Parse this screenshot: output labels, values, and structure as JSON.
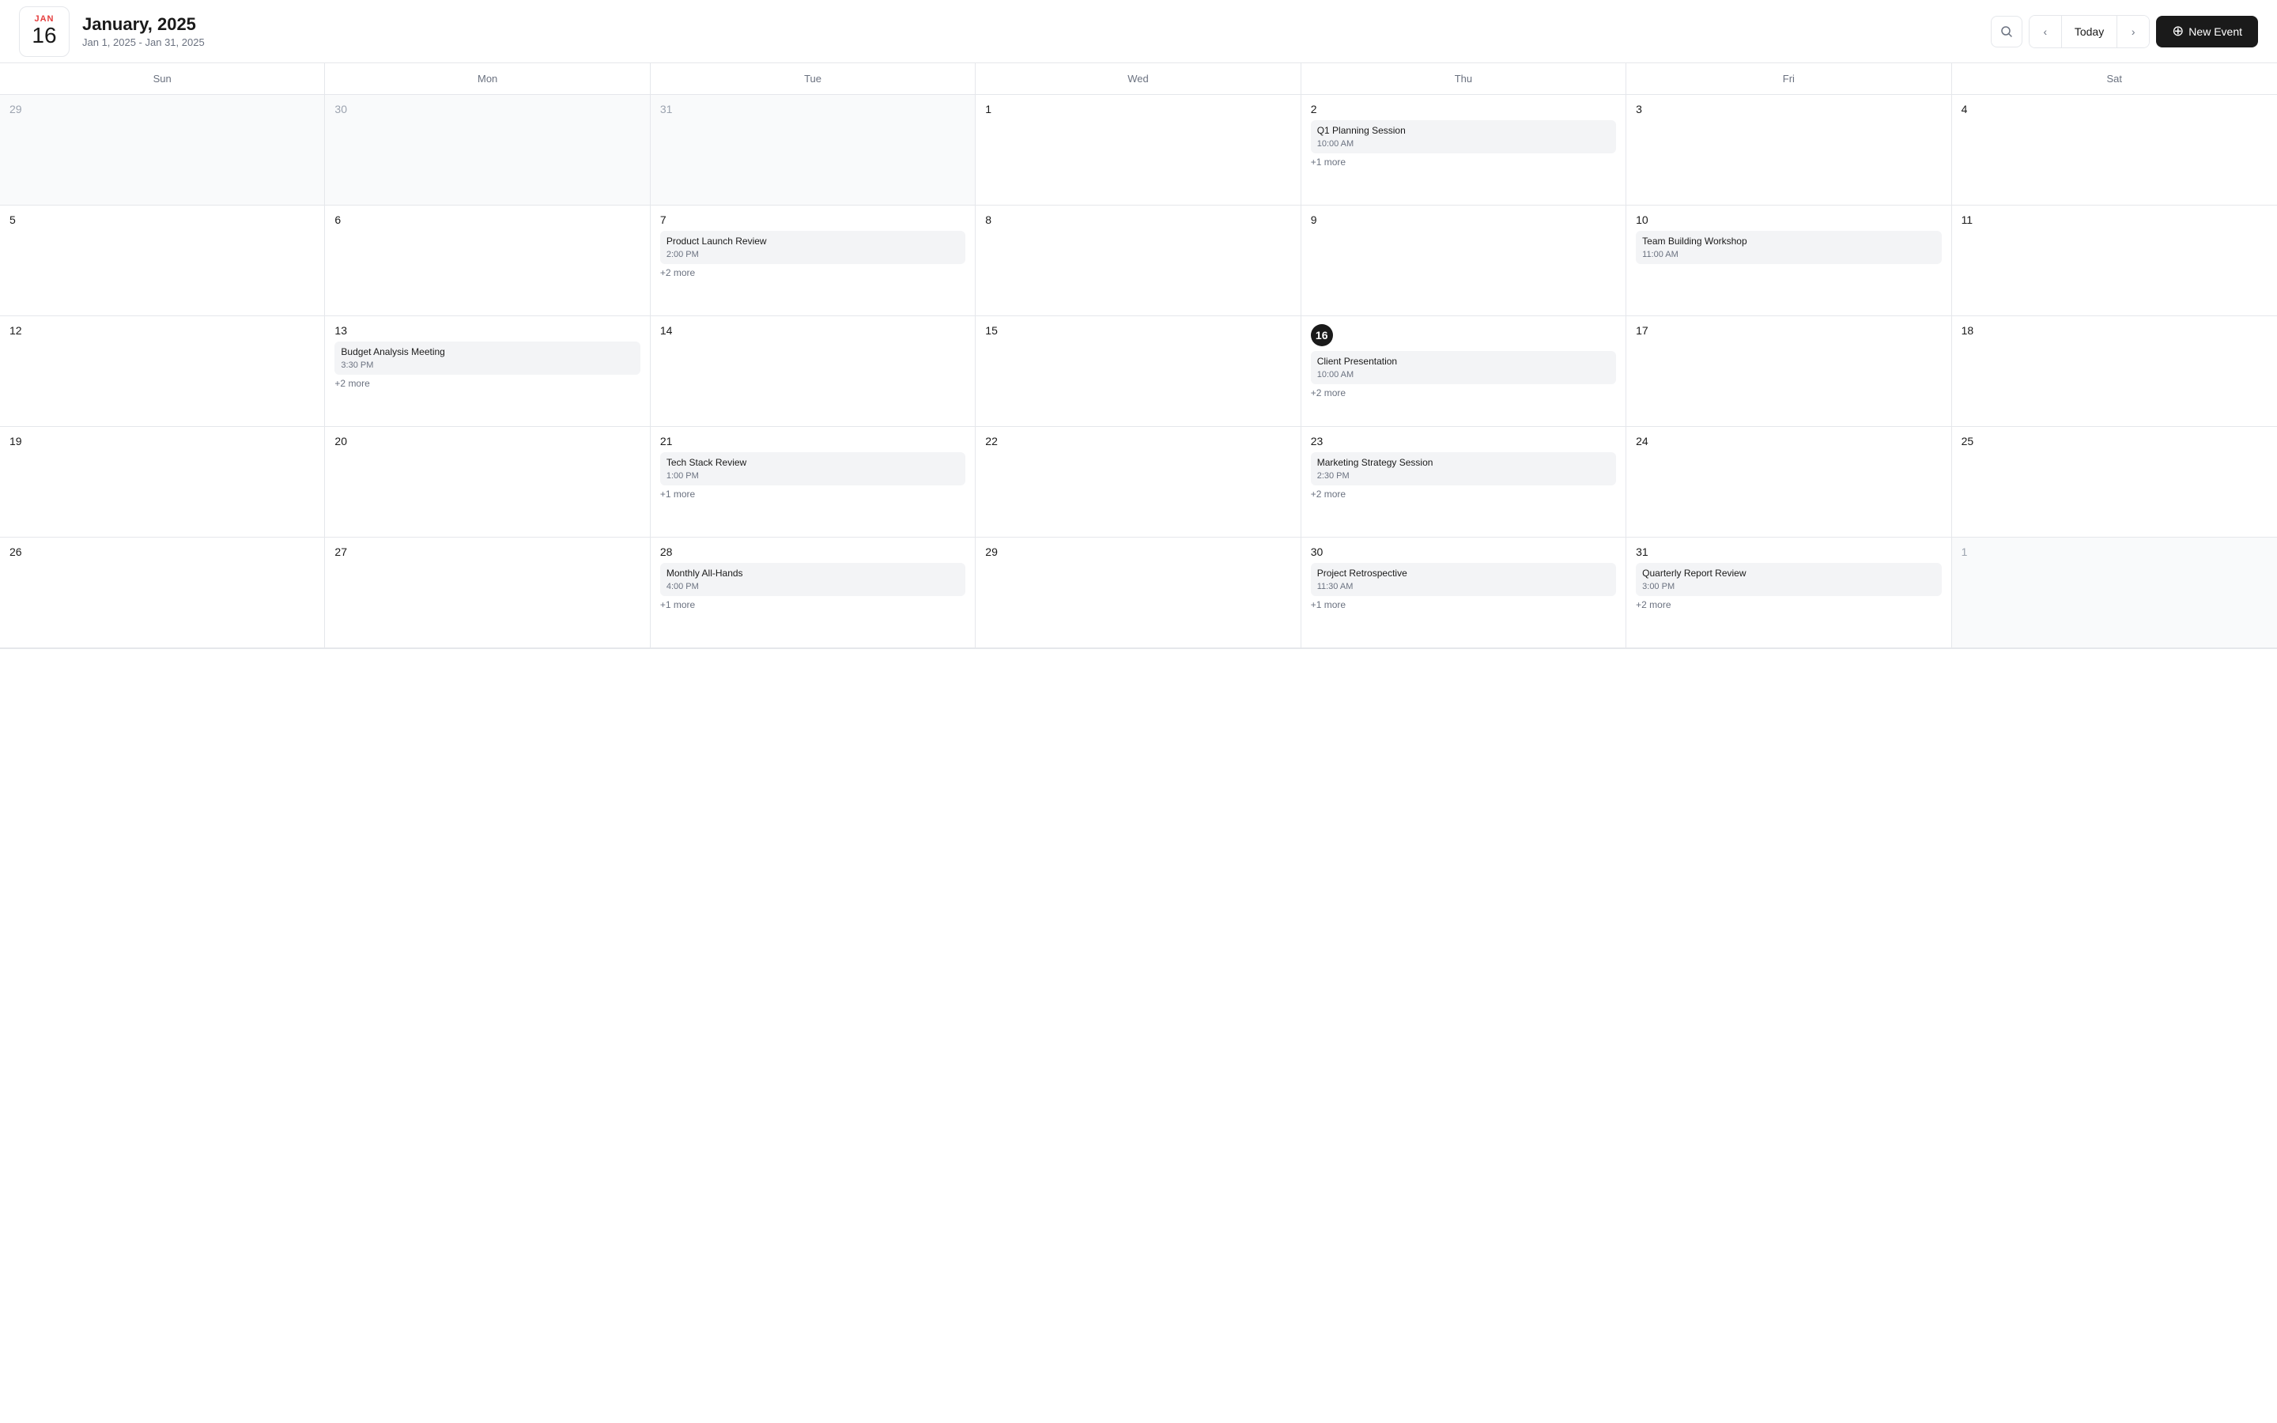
{
  "header": {
    "badge_month": "JAN",
    "badge_day": "16",
    "title": "January, 2025",
    "subtitle": "Jan 1, 2025 - Jan 31, 2025",
    "today_label": "Today",
    "new_event_label": "New Event"
  },
  "day_headers": [
    "Sun",
    "Mon",
    "Tue",
    "Wed",
    "Thu",
    "Fri",
    "Sat"
  ],
  "weeks": [
    {
      "days": [
        {
          "num": "29",
          "other": true,
          "events": []
        },
        {
          "num": "30",
          "other": true,
          "events": []
        },
        {
          "num": "31",
          "other": true,
          "events": []
        },
        {
          "num": "1",
          "other": false,
          "events": []
        },
        {
          "num": "2",
          "other": false,
          "events": [
            {
              "title": "Q1 Planning Session",
              "time": "10:00 AM"
            }
          ],
          "more": "+1 more"
        },
        {
          "num": "3",
          "other": false,
          "events": []
        },
        {
          "num": "4",
          "other": false,
          "events": []
        }
      ]
    },
    {
      "days": [
        {
          "num": "5",
          "other": false,
          "events": []
        },
        {
          "num": "6",
          "other": false,
          "events": []
        },
        {
          "num": "7",
          "other": false,
          "events": [
            {
              "title": "Product Launch Review",
              "time": "2:00 PM"
            }
          ],
          "more": "+2 more"
        },
        {
          "num": "8",
          "other": false,
          "events": []
        },
        {
          "num": "9",
          "other": false,
          "events": []
        },
        {
          "num": "10",
          "other": false,
          "events": [
            {
              "title": "Team Building Workshop",
              "time": "11:00 AM"
            }
          ]
        },
        {
          "num": "11",
          "other": false,
          "events": []
        }
      ]
    },
    {
      "days": [
        {
          "num": "12",
          "other": false,
          "events": []
        },
        {
          "num": "13",
          "other": false,
          "events": [
            {
              "title": "Budget Analysis Meeting",
              "time": "3:30 PM"
            }
          ],
          "more": "+2 more"
        },
        {
          "num": "14",
          "other": false,
          "events": []
        },
        {
          "num": "15",
          "other": false,
          "events": []
        },
        {
          "num": "16",
          "other": false,
          "today": true,
          "events": [
            {
              "title": "Client Presentation",
              "time": "10:00 AM"
            }
          ],
          "more": "+2 more"
        },
        {
          "num": "17",
          "other": false,
          "events": []
        },
        {
          "num": "18",
          "other": false,
          "events": []
        }
      ]
    },
    {
      "days": [
        {
          "num": "19",
          "other": false,
          "events": []
        },
        {
          "num": "20",
          "other": false,
          "events": []
        },
        {
          "num": "21",
          "other": false,
          "events": [
            {
              "title": "Tech Stack Review",
              "time": "1:00 PM"
            }
          ],
          "more": "+1 more"
        },
        {
          "num": "22",
          "other": false,
          "events": []
        },
        {
          "num": "23",
          "other": false,
          "events": [
            {
              "title": "Marketing Strategy Session",
              "time": "2:30 PM"
            }
          ],
          "more": "+2 more"
        },
        {
          "num": "24",
          "other": false,
          "events": []
        },
        {
          "num": "25",
          "other": false,
          "events": []
        }
      ]
    },
    {
      "days": [
        {
          "num": "26",
          "other": false,
          "events": []
        },
        {
          "num": "27",
          "other": false,
          "events": []
        },
        {
          "num": "28",
          "other": false,
          "events": [
            {
              "title": "Monthly All-Hands",
              "time": "4:00 PM"
            }
          ],
          "more": "+1 more"
        },
        {
          "num": "29",
          "other": false,
          "events": []
        },
        {
          "num": "30",
          "other": false,
          "events": [
            {
              "title": "Project Retrospective",
              "time": "11:30 AM"
            }
          ],
          "more": "+1 more"
        },
        {
          "num": "31",
          "other": false,
          "events": [
            {
              "title": "Quarterly Report Review",
              "time": "3:00 PM"
            }
          ],
          "more": "+2 more"
        },
        {
          "num": "1",
          "other": true,
          "events": []
        }
      ]
    }
  ]
}
